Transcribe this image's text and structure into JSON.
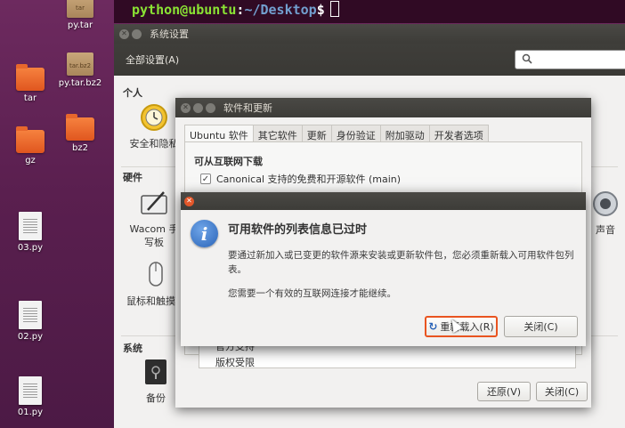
{
  "desktop": {
    "icons": [
      {
        "name": "py.tar",
        "badge": "tar"
      },
      {
        "name": "tar"
      },
      {
        "name": "py.tar.bz2",
        "badge": "tar.bz2"
      },
      {
        "name": "gz"
      },
      {
        "name": "bz2"
      },
      {
        "name": "03.py"
      },
      {
        "name": "02.py"
      },
      {
        "name": "01.py"
      }
    ]
  },
  "terminal": {
    "user_host": "python@ubuntu",
    "separator": ":",
    "path": "~/Desktop",
    "prompt": "$"
  },
  "settings_window": {
    "title": "系统设置",
    "all_settings": "全部设置(A)",
    "sections": {
      "personal": "个人",
      "hardware": "硬件",
      "system": "系统"
    },
    "items": {
      "security": "安全和隐私",
      "wacom": "Wacom 手写板",
      "mouse": "鼠标和触摸板",
      "sound": "声音",
      "backup": "备份"
    }
  },
  "software_window": {
    "title": "软件和更新",
    "tabs": [
      "Ubuntu 软件",
      "其它软件",
      "更新",
      "身份验证",
      "附加驱动",
      "开发者选项"
    ],
    "panel_heading": "可从互联网下载",
    "main_option": "Canonical 支持的免费和开源软件 (main)",
    "list_items": [
      "官方支持",
      "版权受限"
    ],
    "buttons": {
      "revert": "还原(V)",
      "close": "关闭(C)"
    }
  },
  "dialog": {
    "title": "可用软件的列表信息已过时",
    "message": "要通过新加入或已变更的软件源来安装或更新软件包，您必须重新载入可用软件包列表。",
    "note": "您需要一个有效的互联网连接才能继续。",
    "buttons": {
      "reload": "重新载入(R)",
      "close": "关闭(C)"
    }
  },
  "colors": {
    "accent": "#e95420",
    "terminal_bg": "#300a24",
    "prompt_user": "#8ae234",
    "prompt_path": "#729fcf"
  }
}
